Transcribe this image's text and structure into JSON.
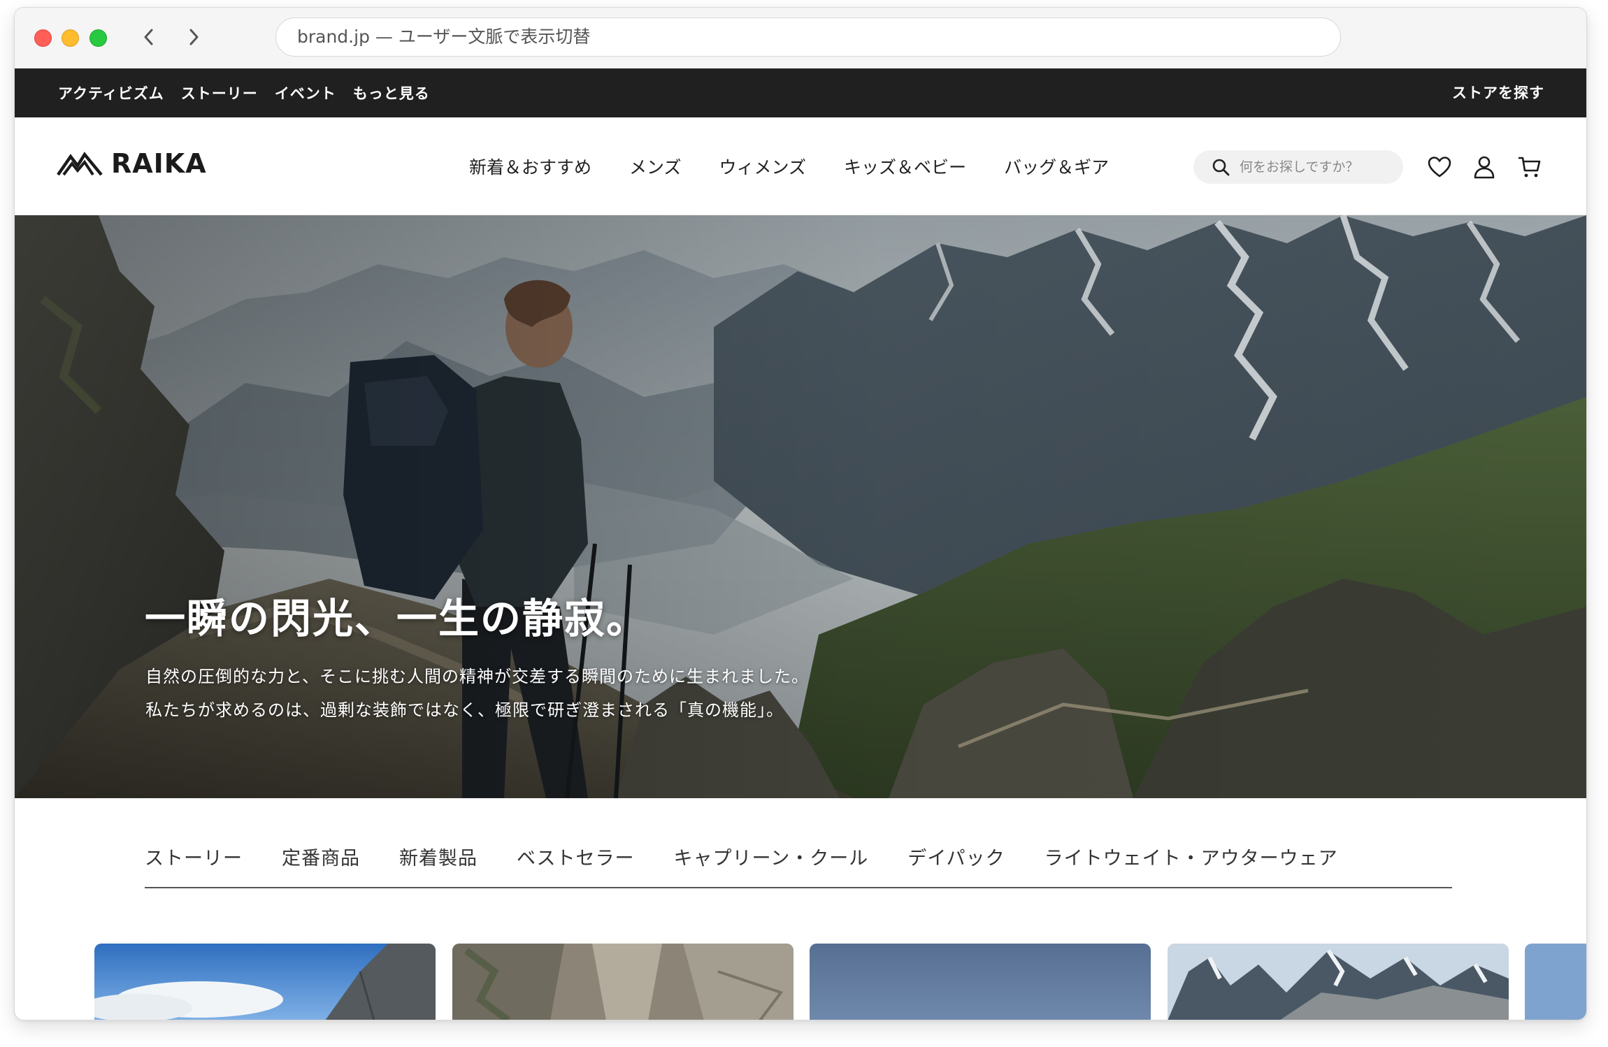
{
  "browser": {
    "url": "brand.jp — ユーザー文脈で表示切替"
  },
  "utility_bar": {
    "links": [
      "アクティビズム",
      "ストーリー",
      "イベント",
      "もっと見る"
    ],
    "store_link": "ストアを探す"
  },
  "header": {
    "logo_text": "RAIKA",
    "nav": [
      "新着＆おすすめ",
      "メンズ",
      "ウィメンズ",
      "キッズ＆ベビー",
      "バッグ＆ギア"
    ],
    "search_placeholder": "何をお探しですか？",
    "icons": [
      "heart-icon",
      "user-icon",
      "cart-icon"
    ]
  },
  "hero": {
    "title": "一瞬の閃光、一生の静寂。",
    "lines": [
      "自然の圧倒的な力と、そこに挑む人間の精神が交差する瞬間のために生まれました。",
      "私たちが求めるのは、過剰な装飾ではなく、極限で研ぎ澄まされる「真の機能」。"
    ]
  },
  "category_tabs": [
    "ストーリー",
    "定番商品",
    "新着製品",
    "ベストセラー",
    "キャプリーン・クール",
    "デイパック",
    "ライトウェイト・アウターウェア"
  ],
  "colors": {
    "utility_bar_bg": "#202020",
    "accent_text": "#222222"
  }
}
